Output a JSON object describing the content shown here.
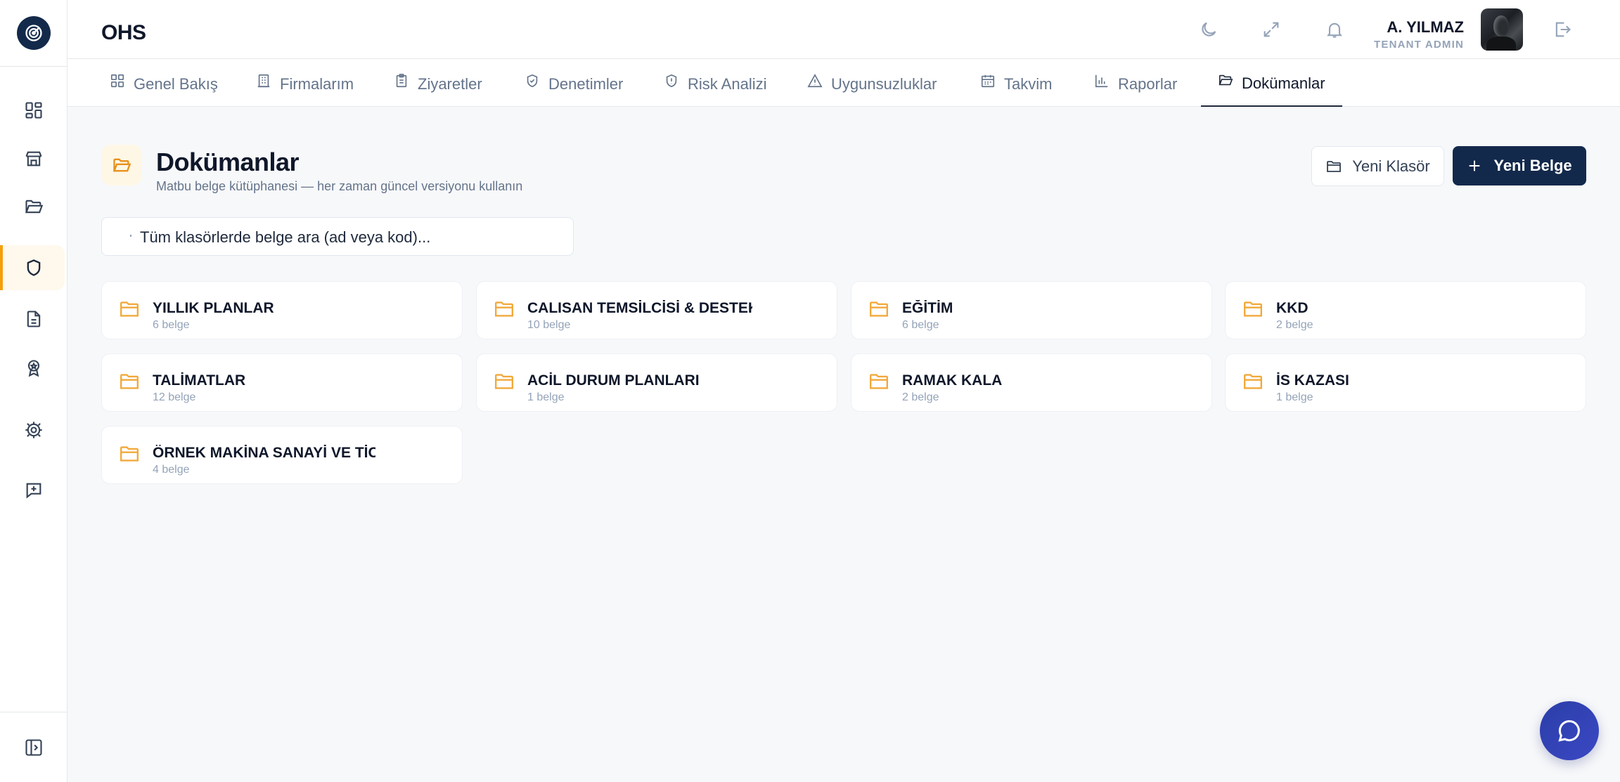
{
  "app": {
    "title": "OHS"
  },
  "user": {
    "name": "A. YILMAZ",
    "role": "TENANT ADMIN"
  },
  "tabs": [
    {
      "label": "Genel Bakış",
      "icon": "dashboard-icon"
    },
    {
      "label": "Firmalarım",
      "icon": "building-icon"
    },
    {
      "label": "Ziyaretler",
      "icon": "clipboard-icon"
    },
    {
      "label": "Denetimler",
      "icon": "shield-check-icon"
    },
    {
      "label": "Risk Analizi",
      "icon": "shield-alert-icon"
    },
    {
      "label": "Uygunsuzluklar",
      "icon": "warning-icon"
    },
    {
      "label": "Takvim",
      "icon": "calendar-icon"
    },
    {
      "label": "Raporlar",
      "icon": "bar-chart-icon"
    },
    {
      "label": "Dokümanlar",
      "icon": "folder-open-icon",
      "active": true
    }
  ],
  "page": {
    "title": "Dokümanlar",
    "subtitle": "Matbu belge kütüphanesi — her zaman güncel versiyonu kullanın",
    "new_folder_label": "Yeni Klasör",
    "new_doc_label": "Yeni Belge",
    "search_placeholder": "Tüm klasörlerde belge ara (ad veya kod)..."
  },
  "folders": [
    {
      "name": "YILLIK PLANLAR",
      "count": "6 belge"
    },
    {
      "name": "CALISAN TEMSİLCİSİ & DESTEK",
      "count": "10 belge"
    },
    {
      "name": "EĞİTİM",
      "count": "6 belge"
    },
    {
      "name": "KKD",
      "count": "2 belge"
    },
    {
      "name": "TALİMATLAR",
      "count": "12 belge"
    },
    {
      "name": "ACİL DURUM PLANLARI",
      "count": "1 belge"
    },
    {
      "name": "RAMAK KALA",
      "count": "2 belge"
    },
    {
      "name": "İS KAZASI",
      "count": "1 belge"
    },
    {
      "name": "ÖRNEK MAKİNA SANAYİ VE TİC",
      "count": "4 belge"
    }
  ],
  "colors": {
    "brand": "#13294b",
    "accent": "#f59e0b",
    "folder": "#f2a93b",
    "fab": "#2f3fb0"
  }
}
